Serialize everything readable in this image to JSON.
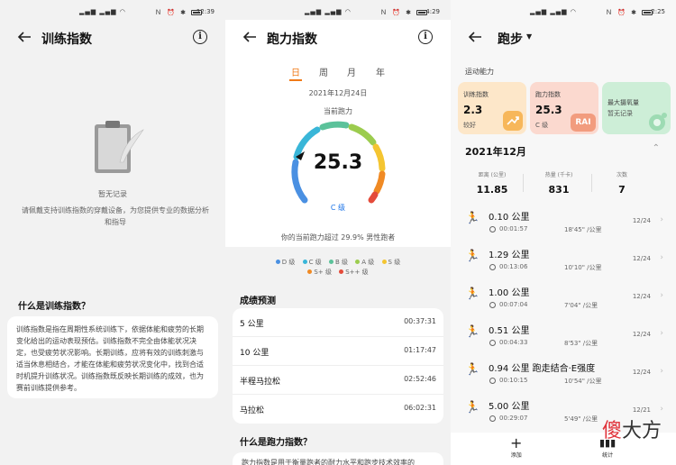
{
  "screen1": {
    "time": "12:39",
    "title": "训练指数",
    "empty_title": "暂无记录",
    "empty_desc": "请佩戴支持训练指数的穿戴设备，为您提供专业的数据分析和指导",
    "what_title": "什么是训练指数？",
    "what_desc": "训练指数是指在周期性系统训练下，依据体能和疲劳的长期变化给出的运动表现预估。训练指数不完全由体能状况决定，也受疲劳状况影响。长期训练，应将有效的训练刺激与适当休息相结合，才能在体能和疲劳状况变化中，找到合适时机提升训练状况。训练指数既反映长期训练的成效，也为赛前训练提供参考。"
  },
  "screen2": {
    "time": "4:29",
    "title": "跑力指数",
    "periods": [
      "日",
      "周",
      "月",
      "年"
    ],
    "active_period": "日",
    "date": "2021年12月24日",
    "current_label": "当前跑力",
    "score": "25.3",
    "grade": "C 级",
    "exceed_text": "你的当前跑力超过 29.9% 男性跑者",
    "legend": [
      {
        "label": "D 级",
        "color": "#4a90e2"
      },
      {
        "label": "C 级",
        "color": "#39b6d8"
      },
      {
        "label": "B 级",
        "color": "#5bc29a"
      },
      {
        "label": "A 级",
        "color": "#9ccc4e"
      },
      {
        "label": "S 级",
        "color": "#f4c531"
      },
      {
        "label": "S+ 级",
        "color": "#f08a24"
      },
      {
        "label": "S++ 级",
        "color": "#e44b3a"
      }
    ],
    "pred_title": "成绩预测",
    "predictions": [
      {
        "name": "5 公里",
        "time": "00:37:31"
      },
      {
        "name": "10 公里",
        "time": "01:17:47"
      },
      {
        "name": "半程马拉松",
        "time": "02:52:46"
      },
      {
        "name": "马拉松",
        "time": "06:02:31"
      }
    ],
    "what_title": "什么是跑力指数？",
    "what_desc_partial": "跑力指数是用于衡量跑者的耐力水平和跑步技术效率的"
  },
  "screen3": {
    "time": "2:25",
    "title": "跑步",
    "capacity_label": "运动能力",
    "cards": [
      {
        "label": "训练指数",
        "value": "2.3",
        "sub": "较好",
        "badge": "",
        "color": "#fde7c9"
      },
      {
        "label": "跑力指数",
        "value": "25.3",
        "sub": "C 级",
        "badge": "RAI",
        "color": "#fbd9cf"
      },
      {
        "label": "最大摄氧量",
        "value": "",
        "sub": "暂无记录",
        "badge": "",
        "color": "#cdeed7"
      }
    ],
    "month": "2021年12月",
    "stats": [
      {
        "label": "距离 (公里)",
        "value": "11.85"
      },
      {
        "label": "热量 (千卡)",
        "value": "831"
      },
      {
        "label": "次数",
        "value": "7"
      }
    ],
    "runs": [
      {
        "distance": "0.10 公里",
        "duration": "00:01:57",
        "pace": "18'45\" /公里",
        "date": "12/24"
      },
      {
        "distance": "1.29 公里",
        "duration": "00:13:06",
        "pace": "10'10\" /公里",
        "date": "12/24"
      },
      {
        "distance": "1.00 公里",
        "duration": "00:07:04",
        "pace": "7'04\" /公里",
        "date": "12/24"
      },
      {
        "distance": "0.51 公里",
        "duration": "00:04:33",
        "pace": "8'53\" /公里",
        "date": "12/24"
      },
      {
        "distance": "0.94 公里 跑走结合·E强度",
        "duration": "00:10:15",
        "pace": "10'54\" /公里",
        "date": "12/24"
      },
      {
        "distance": "5.00 公里",
        "duration": "00:29:07",
        "pace": "5'49\" /公里",
        "date": "12/21"
      }
    ],
    "tab_add": "添加",
    "tab_stats": "统计",
    "watermark_first": "傻",
    "watermark_rest": "大方"
  },
  "colors": {
    "accent": "#f07a18",
    "link": "#1a73e8"
  }
}
